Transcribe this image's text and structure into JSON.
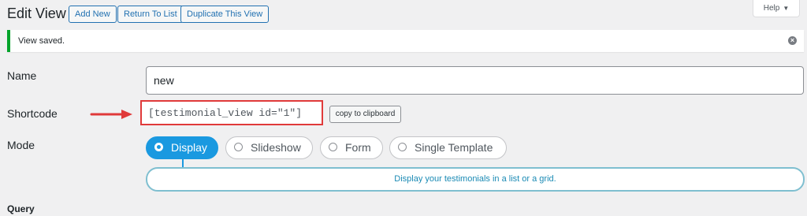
{
  "header": {
    "title": "Edit View",
    "buttons": [
      "Add New",
      "Return To List",
      "Duplicate This View"
    ],
    "help_label": "Help"
  },
  "notice": {
    "text": "View saved.",
    "status_color": "#00a32a"
  },
  "form": {
    "name_label": "Name",
    "name_value": "new",
    "shortcode_label": "Shortcode",
    "shortcode_value": "[testimonial_view id=\"1\"]",
    "copy_label": "copy to clipboard",
    "mode_label": "Mode",
    "modes": [
      {
        "label": "Display",
        "selected": true
      },
      {
        "label": "Slideshow",
        "selected": false
      },
      {
        "label": "Form",
        "selected": false
      },
      {
        "label": "Single Template",
        "selected": false
      }
    ],
    "mode_description": "Display your testimonials in a list or a grid.",
    "query_label": "Query"
  },
  "annotation": {
    "highlight_color": "#e03a3a"
  },
  "theme": {
    "accent": "#1a99e0",
    "link": "#2271b1"
  }
}
